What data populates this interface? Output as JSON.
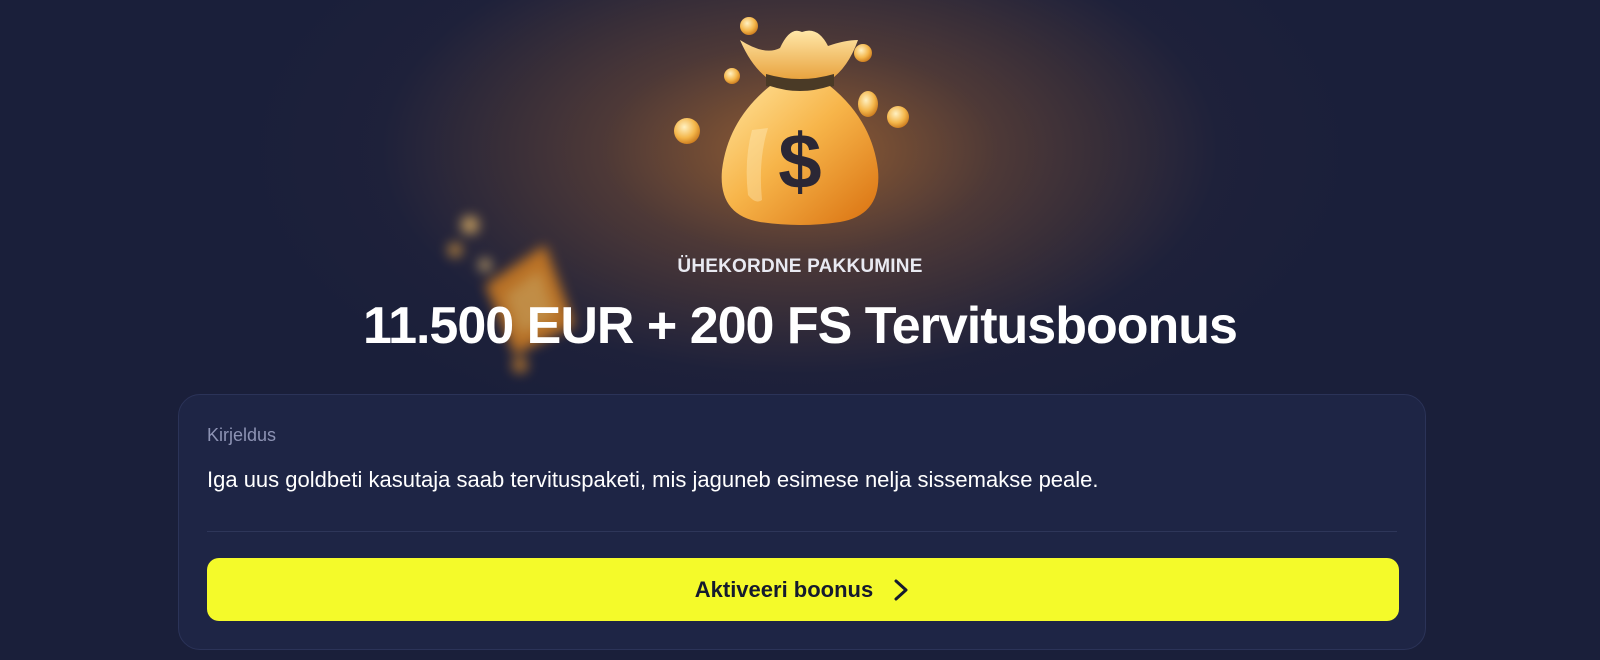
{
  "offer": {
    "eyebrow": "ÜHEKORDNE PAKKUMINE",
    "title": "11.500 EUR + 200 FS Tervitusboonus"
  },
  "details": {
    "label": "Kirjeldus",
    "description": "Iga uus goldbeti kasutaja saab tervituspaketi, mis jaguneb esimese nelja sissemakse peale."
  },
  "cta": {
    "label": "Aktiveeri boonus",
    "icon": "chevron-right-icon"
  },
  "illustration": {
    "icon": "money-bag-icon",
    "symbol": "$"
  },
  "colors": {
    "background": "#1a1f3a",
    "card": "#1e2545",
    "accent": "#f4fa2a",
    "gold": "#f0a232"
  }
}
